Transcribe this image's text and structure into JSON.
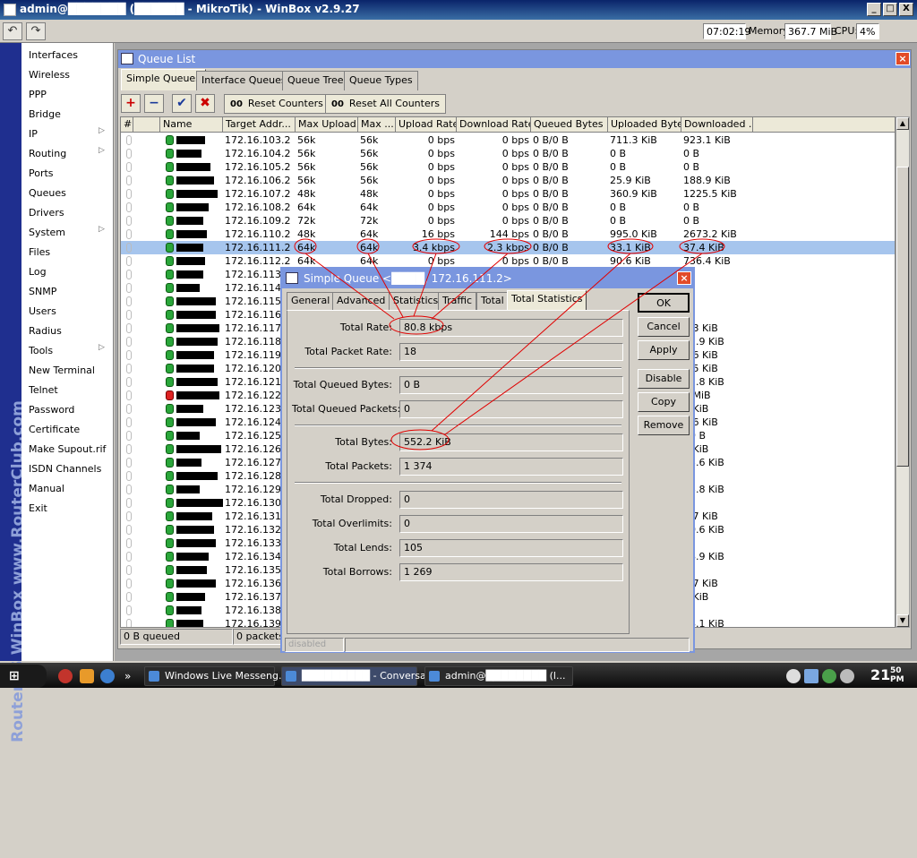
{
  "window": {
    "title": "admin@███████ (██████ - MikroTik) - WinBox v2.9.27",
    "buttons": {
      "minimize": "_",
      "maximize": "□",
      "close": "X"
    }
  },
  "toolbar": {
    "undo_icon": "undo-icon",
    "redo_icon": "redo-icon",
    "time": "07:02:19",
    "memory_label": "Memory:",
    "memory_value": "367.7 MiB",
    "cpu_label": "CPU:",
    "cpu_value": "4%"
  },
  "brand": {
    "text": "RouterOS WinBox   www.RouterClub.com"
  },
  "menu": {
    "items": [
      {
        "label": "Interfaces",
        "submenu": false
      },
      {
        "label": "Wireless",
        "submenu": false
      },
      {
        "label": "PPP",
        "submenu": false
      },
      {
        "label": "Bridge",
        "submenu": false
      },
      {
        "label": "IP",
        "submenu": true
      },
      {
        "label": "Routing",
        "submenu": true
      },
      {
        "label": "Ports",
        "submenu": false
      },
      {
        "label": "Queues",
        "submenu": false
      },
      {
        "label": "Drivers",
        "submenu": false
      },
      {
        "label": "System",
        "submenu": true
      },
      {
        "label": "Files",
        "submenu": false
      },
      {
        "label": "Log",
        "submenu": false
      },
      {
        "label": "SNMP",
        "submenu": false
      },
      {
        "label": "Users",
        "submenu": false
      },
      {
        "label": "Radius",
        "submenu": false
      },
      {
        "label": "Tools",
        "submenu": true
      },
      {
        "label": "New Terminal",
        "submenu": false
      },
      {
        "label": "Telnet",
        "submenu": false
      },
      {
        "label": "Password",
        "submenu": false
      },
      {
        "label": "Certificate",
        "submenu": false
      },
      {
        "label": "Make Supout.rif",
        "submenu": false
      },
      {
        "label": "ISDN Channels",
        "submenu": false
      },
      {
        "label": "Manual",
        "submenu": false
      },
      {
        "label": "Exit",
        "submenu": false
      }
    ]
  },
  "queue_list": {
    "title": "Queue List",
    "tabs": [
      "Simple Queues",
      "Interface Queues",
      "Queue Tree",
      "Queue Types"
    ],
    "active_tab": "Simple Queues",
    "icons": {
      "add": "+",
      "remove": "−",
      "enable": "✔",
      "disable": "✖"
    },
    "reset_counters": "Reset Counters",
    "reset_all_counters": "Reset All Counters",
    "reset_icon_text": "00",
    "columns": [
      "#",
      "Name",
      "Target Addr...",
      "Max Upload...",
      "Max ...",
      "Upload Rate",
      "Download Rate",
      "Queued Bytes",
      "Uploaded Bytes",
      "Downloaded ..."
    ],
    "rows": [
      {
        "target": "172.16.103.2",
        "max_up": "56k",
        "max_down": "56k",
        "up_rate": "0 bps",
        "down_rate": "0 bps",
        "queued": "0 B/0 B",
        "uploaded": "711.3 KiB",
        "downloaded": "923.1 KiB",
        "name_w": 32
      },
      {
        "target": "172.16.104.2",
        "max_up": "56k",
        "max_down": "56k",
        "up_rate": "0 bps",
        "down_rate": "0 bps",
        "queued": "0 B/0 B",
        "uploaded": "0 B",
        "downloaded": "0 B",
        "name_w": 28
      },
      {
        "target": "172.16.105.2",
        "max_up": "56k",
        "max_down": "56k",
        "up_rate": "0 bps",
        "down_rate": "0 bps",
        "queued": "0 B/0 B",
        "uploaded": "0 B",
        "downloaded": "0 B",
        "name_w": 38
      },
      {
        "target": "172.16.106.2",
        "max_up": "56k",
        "max_down": "56k",
        "up_rate": "0 bps",
        "down_rate": "0 bps",
        "queued": "0 B/0 B",
        "uploaded": "25.9 KiB",
        "downloaded": "188.9 KiB",
        "name_w": 42
      },
      {
        "target": "172.16.107.2",
        "max_up": "48k",
        "max_down": "48k",
        "up_rate": "0 bps",
        "down_rate": "0 bps",
        "queued": "0 B/0 B",
        "uploaded": "360.9 KiB",
        "downloaded": "1225.5 KiB",
        "name_w": 46
      },
      {
        "target": "172.16.108.2",
        "max_up": "64k",
        "max_down": "64k",
        "up_rate": "0 bps",
        "down_rate": "0 bps",
        "queued": "0 B/0 B",
        "uploaded": "0 B",
        "downloaded": "0 B",
        "name_w": 36
      },
      {
        "target": "172.16.109.2",
        "max_up": "72k",
        "max_down": "72k",
        "up_rate": "0 bps",
        "down_rate": "0 bps",
        "queued": "0 B/0 B",
        "uploaded": "0 B",
        "downloaded": "0 B",
        "name_w": 30
      },
      {
        "target": "172.16.110.2",
        "max_up": "48k",
        "max_down": "64k",
        "up_rate": "16 bps",
        "down_rate": "144 bps",
        "queued": "0 B/0 B",
        "uploaded": "995.0 KiB",
        "downloaded": "2673.2 KiB",
        "name_w": 34
      },
      {
        "target": "172.16.111.2",
        "max_up": "64k",
        "max_down": "64k",
        "up_rate": "3.4 kbps",
        "down_rate": "2.3 kbps",
        "queued": "0 B/0 B",
        "uploaded": "33.1 KiB",
        "downloaded": "37.4 KiB",
        "name_w": 30,
        "selected": true
      },
      {
        "target": "172.16.112.2",
        "max_up": "64k",
        "max_down": "64k",
        "up_rate": "0 bps",
        "down_rate": "0 bps",
        "queued": "0 B/0 B",
        "uploaded": "90.6 KiB",
        "downloaded": "736.4 KiB",
        "name_w": 32
      },
      {
        "target": "172.16.113.2",
        "name_w": 30
      },
      {
        "target": "172.16.114.2",
        "name_w": 26
      },
      {
        "target": "172.16.115.2",
        "name_w": 44
      },
      {
        "target": "172.16.116.2",
        "name_w": 44
      },
      {
        "target": "172.16.117.2",
        "downloaded": "2.3 KiB",
        "name_w": 48
      },
      {
        "target": "172.16.118.2",
        "downloaded": "45.9 KiB",
        "name_w": 46
      },
      {
        "target": "172.16.119.2",
        "downloaded": "9.6 KiB",
        "name_w": 42
      },
      {
        "target": "172.16.120.2",
        "downloaded": "2.5 KiB",
        "name_w": 42
      },
      {
        "target": "172.16.121.2",
        "downloaded": "02.8 KiB",
        "name_w": 46
      },
      {
        "target": "172.16.122.2",
        "downloaded": "2 MiB",
        "name_w": 48,
        "disabled": true
      },
      {
        "target": "172.16.123.2",
        "downloaded": "5 KiB",
        "name_w": 30
      },
      {
        "target": "172.16.124.2",
        "downloaded": "7.6 KiB",
        "name_w": 44
      },
      {
        "target": "172.16.125.2",
        "downloaded": "99 B",
        "name_w": 26
      },
      {
        "target": "172.16.126.2",
        "downloaded": "1 KiB",
        "name_w": 50
      },
      {
        "target": "172.16.127.2",
        "downloaded": "23.6 KiB",
        "name_w": 28
      },
      {
        "target": "172.16.128.2",
        "name_w": 46
      },
      {
        "target": "172.16.129.2",
        "downloaded": "93.8 KiB",
        "name_w": 26
      },
      {
        "target": "172.16.130.2",
        "name_w": 52
      },
      {
        "target": "172.16.131.2",
        "downloaded": "2.7 KiB",
        "name_w": 40
      },
      {
        "target": "172.16.132.2",
        "downloaded": "90.6 KiB",
        "name_w": 42
      },
      {
        "target": "172.16.133.2",
        "name_w": 44
      },
      {
        "target": "172.16.134.2",
        "downloaded": "78.9 KiB",
        "name_w": 36
      },
      {
        "target": "172.16.135.2",
        "name_w": 34
      },
      {
        "target": "172.16.136.2",
        "downloaded": "6.7 KiB",
        "name_w": 44
      },
      {
        "target": "172.16.137.2",
        "downloaded": "3 KiB",
        "name_w": 32
      },
      {
        "target": "172.16.138.2",
        "name_w": 28
      },
      {
        "target": "172.16.139.2",
        "downloaded": "28.1 KiB",
        "name_w": 30
      }
    ],
    "status_queued": "0 B queued",
    "status_packets": "0 packets"
  },
  "dialog": {
    "title": "Simple Queue <████, 172.16.111.2>",
    "tabs": [
      "General",
      "Advanced",
      "Statistics",
      "Traffic",
      "Total",
      "Total Statistics"
    ],
    "active_tab": "Total Statistics",
    "fields": {
      "total_rate": {
        "label": "Total Rate:",
        "value": "80.8 kbps"
      },
      "total_packet_rate": {
        "label": "Total Packet Rate:",
        "value": "18"
      },
      "total_queued_bytes": {
        "label": "Total Queued Bytes:",
        "value": "0 B"
      },
      "total_queued_packets": {
        "label": "Total Queued Packets:",
        "value": "0"
      },
      "total_bytes": {
        "label": "Total Bytes:",
        "value": "552.2 KiB"
      },
      "total_packets": {
        "label": "Total Packets:",
        "value": "1 374"
      },
      "total_dropped": {
        "label": "Total Dropped:",
        "value": "0"
      },
      "total_overlimits": {
        "label": "Total Overlimits:",
        "value": "0"
      },
      "total_lends": {
        "label": "Total Lends:",
        "value": "105"
      },
      "total_borrows": {
        "label": "Total Borrows:",
        "value": "1 269"
      }
    },
    "buttons": {
      "ok": "OK",
      "cancel": "Cancel",
      "apply": "Apply",
      "disable": "Disable",
      "copy": "Copy",
      "remove": "Remove"
    },
    "status": "disabled"
  },
  "taskbar": {
    "start_label": "",
    "chevron": "»",
    "items": [
      {
        "label": "Windows Live Messeng...",
        "active": false
      },
      {
        "label": "█████████ - Conversa (...",
        "active": true
      },
      {
        "label": "admin@████████ (l...",
        "active": false
      }
    ],
    "clock": "21",
    "clock_min": "50",
    "clock_ampm": "PM"
  },
  "colors": {
    "title_bar": "#0a246a",
    "window_title": "#7a96df",
    "selected_row": "#a6c5ed",
    "queue_enabled": "#2aa63a",
    "queue_disabled": "#d22222",
    "annotation": "#e00000"
  }
}
